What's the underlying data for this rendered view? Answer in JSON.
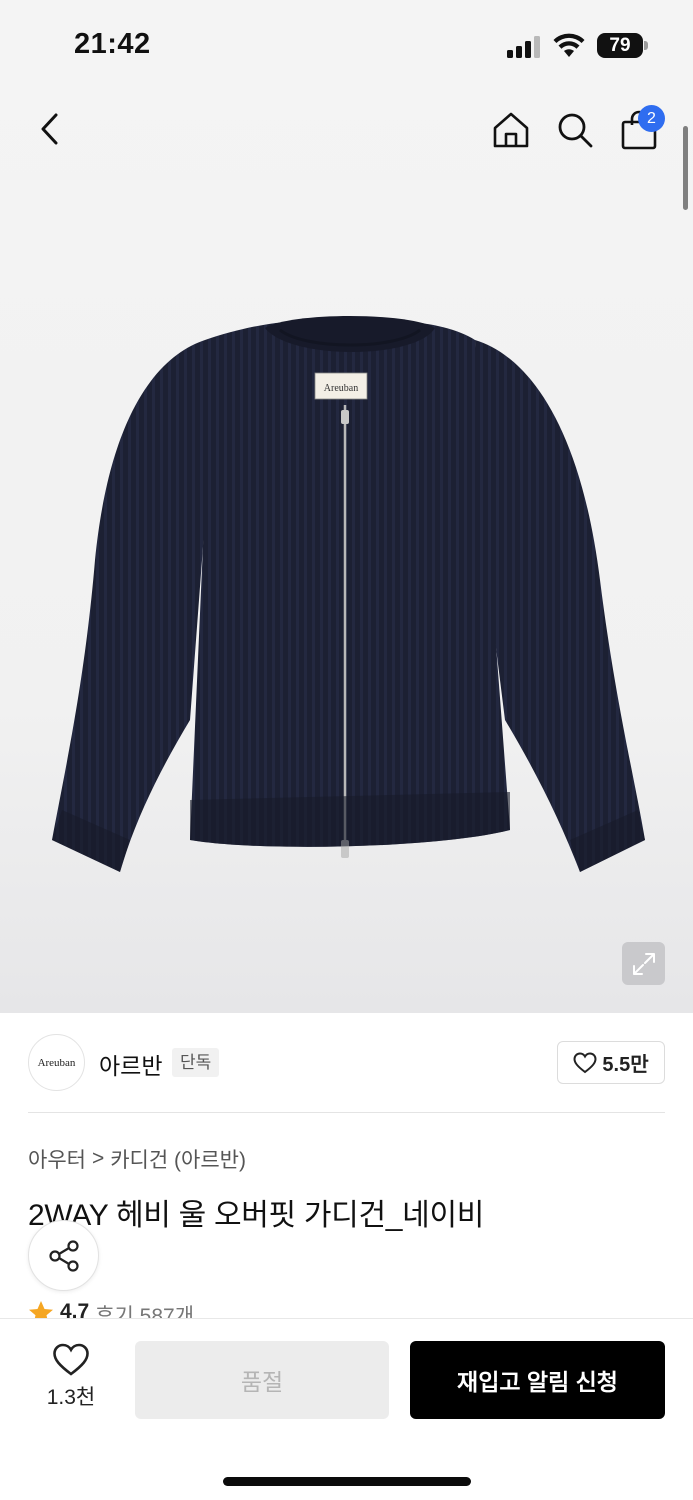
{
  "status_bar": {
    "time": "21:42",
    "battery": "79"
  },
  "nav": {
    "icons": [
      "chevron-left-icon",
      "home-icon",
      "search-icon",
      "shopping-bag-icon"
    ],
    "cart_badge": "2"
  },
  "product": {
    "image_label": "Areuban",
    "expand_icon": "expand-icon"
  },
  "brand": {
    "logo_text": "Areuban",
    "name": "아르반",
    "tag": "단독",
    "likes": "5.5만"
  },
  "breadcrumb": {
    "category": "아우터",
    "separator": ">",
    "subcategory": "카디건 (아르반)"
  },
  "title": "2WAY 헤비 울 오버핏 가디건_네이비",
  "rating": {
    "value": "4.7",
    "reviews": "후기 587개"
  },
  "bottom_bar": {
    "wish_count": "1.3천",
    "soldout_label": "품절",
    "restock_label": "재입고 알림 신청"
  },
  "colors": {
    "accent_badge": "#2f6df0",
    "cta": "#000000",
    "star": "#f5a623",
    "garment": "#1c2033"
  }
}
